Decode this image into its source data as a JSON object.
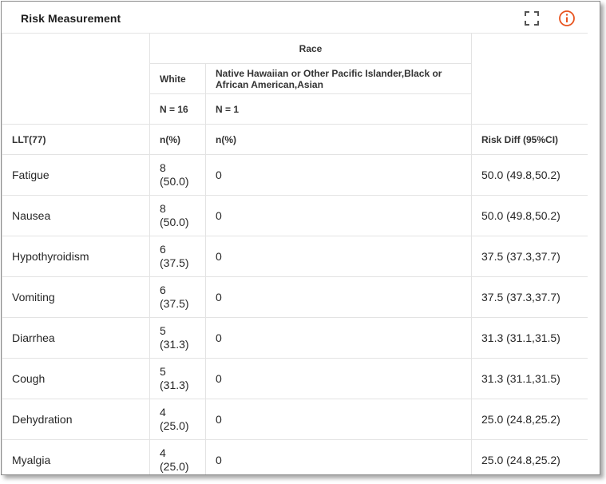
{
  "header": {
    "title": "Risk Measurement",
    "icons": {
      "expand": "expand-icon",
      "info": "info-icon"
    },
    "info_color": "#e8541f"
  },
  "table": {
    "group_header": "Race",
    "groups": [
      {
        "name": "White",
        "n": "N = 16",
        "stat": "n(%)"
      },
      {
        "name": "Native Hawaiian or Other Pacific Islander,Black or African American,Asian",
        "n": "N = 1",
        "stat": "n(%)"
      }
    ],
    "first_col_header": "LLT(77)",
    "risk_header": "Risk Diff (95%CI)",
    "rows": [
      {
        "term": "Fatigue",
        "count": "8",
        "pct": "(50.0)",
        "other": "0",
        "risk": "50.0 (49.8,50.2)"
      },
      {
        "term": "Nausea",
        "count": "8",
        "pct": "(50.0)",
        "other": "0",
        "risk": "50.0 (49.8,50.2)"
      },
      {
        "term": "Hypothyroidism",
        "count": "6",
        "pct": "(37.5)",
        "other": "0",
        "risk": "37.5 (37.3,37.7)"
      },
      {
        "term": "Vomiting",
        "count": "6",
        "pct": "(37.5)",
        "other": "0",
        "risk": "37.5 (37.3,37.7)"
      },
      {
        "term": "Diarrhea",
        "count": "5",
        "pct": "(31.3)",
        "other": "0",
        "risk": "31.3 (31.1,31.5)"
      },
      {
        "term": "Cough",
        "count": "5",
        "pct": "(31.3)",
        "other": "0",
        "risk": "31.3 (31.1,31.5)"
      },
      {
        "term": "Dehydration",
        "count": "4",
        "pct": "(25.0)",
        "other": "0",
        "risk": "25.0 (24.8,25.2)"
      },
      {
        "term": "Myalgia",
        "count": "4",
        "pct": "(25.0)",
        "other": "0",
        "risk": "25.0 (24.8,25.2)"
      }
    ]
  }
}
